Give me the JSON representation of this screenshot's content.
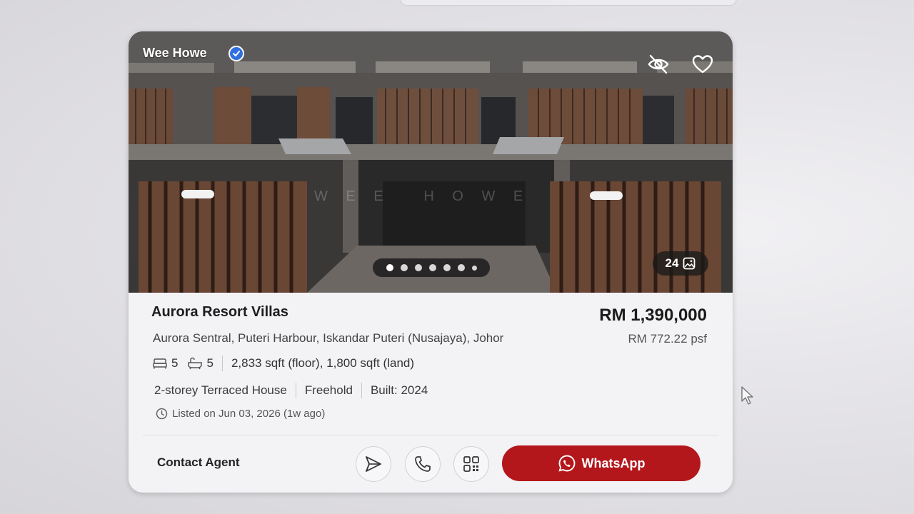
{
  "listing": {
    "agent_name": "Wee Howe",
    "watermark": "W E E   H O W E",
    "gallery": {
      "total_dots": 7,
      "active_index": 0,
      "photo_count": "24"
    },
    "title": "Aurora Resort Villas",
    "price": "RM 1,390,000",
    "price_psf": "RM 772.22 psf",
    "address": "Aurora Sentral, Puteri Harbour, Iskandar Puteri (Nusajaya), Johor",
    "bedrooms": "5",
    "bathrooms": "5",
    "size": "2,833 sqft (floor), 1,800 sqft (land)",
    "property_type": "2-storey Terraced House",
    "tenure": "Freehold",
    "built": "Built: 2024",
    "listed": "Listed on Jun 03, 2026 (1w ago)"
  },
  "contact": {
    "label": "Contact Agent",
    "whatsapp_label": "WhatsApp"
  },
  "colors": {
    "whatsapp_button": "#b3161b",
    "verified_badge": "#2f6fe0"
  },
  "icons": {
    "verified": "verified-check-icon",
    "hide": "eye-off-icon",
    "favorite": "heart-icon",
    "photos": "image-icon",
    "bed": "bed-icon",
    "bath": "bathtub-icon",
    "clock": "clock-icon",
    "send": "send-icon",
    "call": "phone-icon",
    "qr": "qr-code-icon",
    "whatsapp": "whatsapp-icon"
  }
}
